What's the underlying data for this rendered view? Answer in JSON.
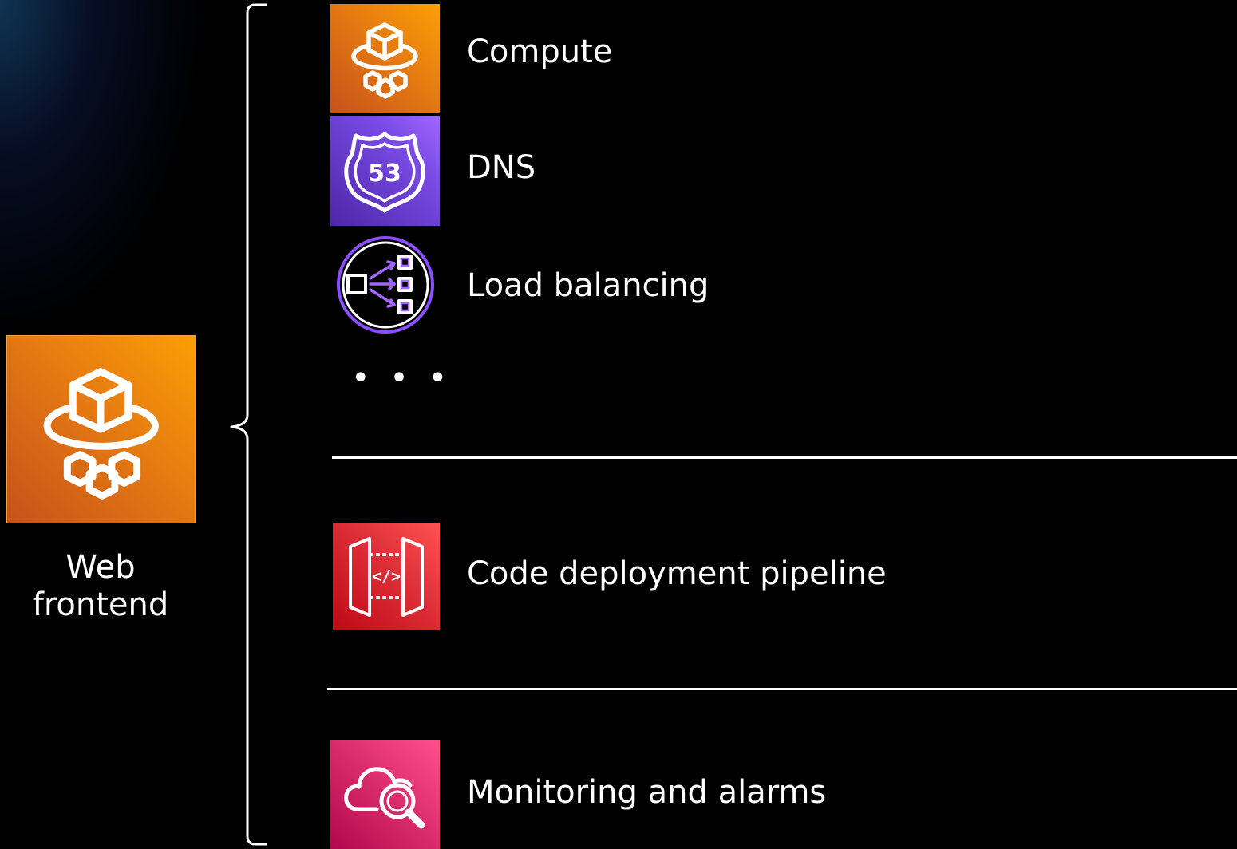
{
  "left": {
    "label_line1": "Web",
    "label_line2": "frontend",
    "icon": "compute-hat-icon"
  },
  "items": [
    {
      "label": "Compute",
      "icon": "compute-hat-icon",
      "color": "#ED7100"
    },
    {
      "label": "DNS",
      "icon": "route53-shield-icon",
      "color": "#8C4FFF"
    },
    {
      "label": "Load balancing",
      "icon": "load-balancer-icon",
      "color": "#8C4FFF"
    },
    {
      "label": "Code deployment pipeline",
      "icon": "codepipeline-icon",
      "color": "#DD344C"
    },
    {
      "label": "Monitoring and alarms",
      "icon": "cloudwatch-icon",
      "color": "#E7157B"
    }
  ],
  "ellipsis": "• • •",
  "dns_badge": "53"
}
